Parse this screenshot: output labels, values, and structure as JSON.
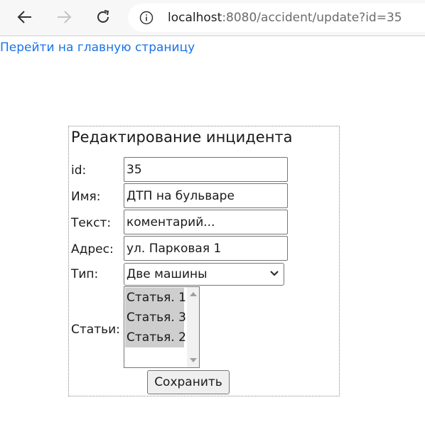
{
  "browser": {
    "url_host": "localhost",
    "url_rest": ":8080/accident/update?id=35",
    "icons": {
      "back": "arrow-left-icon",
      "forward": "arrow-right-icon",
      "reload": "reload-icon",
      "info": "info-icon"
    }
  },
  "page": {
    "home_link": "Перейти на главную страницу",
    "form": {
      "title": "Редактирование инцидента",
      "fields": {
        "id": {
          "label": "id:",
          "value": "35"
        },
        "name": {
          "label": "Имя:",
          "value": "ДТП на бульваре"
        },
        "text": {
          "label": "Текст:",
          "value": "коментарий..."
        },
        "address": {
          "label": "Адрес:",
          "value": "ул. Парковая 1"
        },
        "type": {
          "label": "Тип:",
          "value": "Две машины"
        },
        "articles": {
          "label": "Статьи:",
          "options": [
            "Статья. 1",
            "Статья. 3",
            "Статья. 2"
          ]
        }
      },
      "save_label": "Сохранить"
    }
  },
  "colors": {
    "link": "#1a73e8",
    "selected_option": "#cecece",
    "toolbar": "#f7f7f7"
  }
}
